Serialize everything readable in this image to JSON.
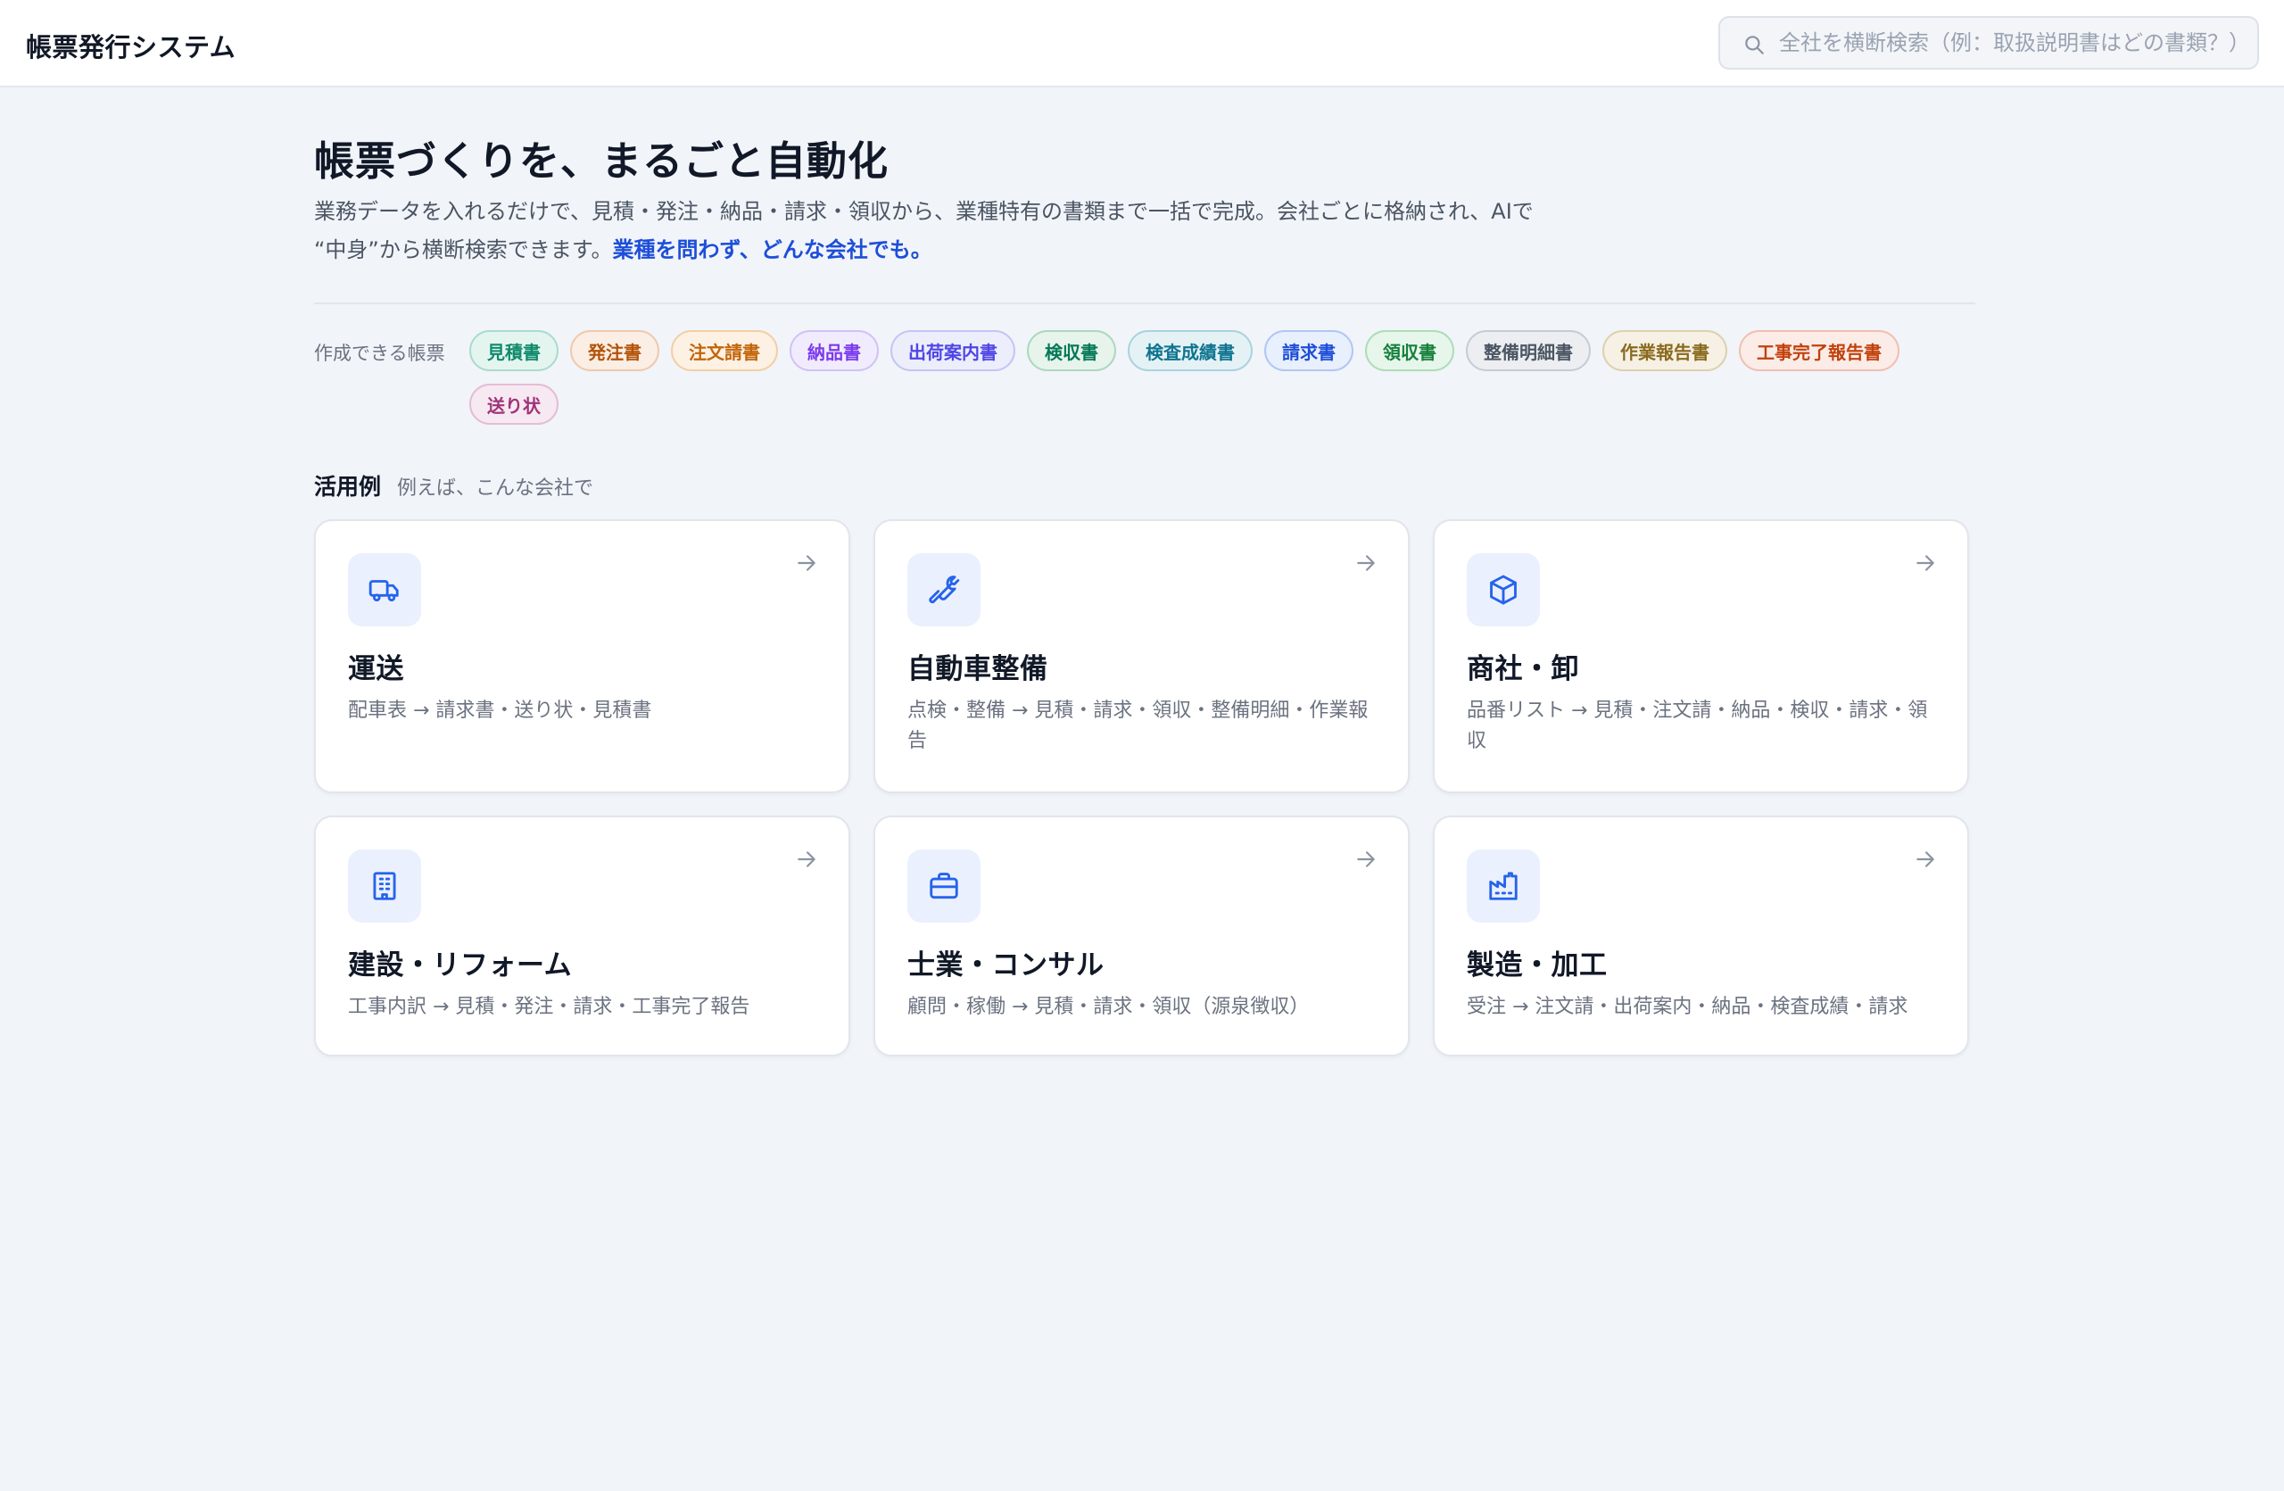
{
  "header": {
    "title": "帳票発行システム",
    "search_placeholder": "全社を横断検索（例：取扱説明書はどの書類？）"
  },
  "hero": {
    "title": "帳票づくりを、まるごと自動化",
    "desc_line1": "業務データを入れるだけで、見積・発注・納品・請求・領収から、業種特有の書類まで一括で完成。会社ごとに格納され、AIで",
    "desc_line2": "“中身”から横断検索できます。",
    "desc_emphasis": "業種を問わず、どんな会社でも。"
  },
  "forms": {
    "label": "作成できる帳票",
    "tags": [
      {
        "label": "見積書",
        "color": "#0f8a6a",
        "bg": "#e4f5ef",
        "border": "#a9dccb"
      },
      {
        "label": "発注書",
        "color": "#b45309",
        "bg": "#fbeee4",
        "border": "#f0c9ad"
      },
      {
        "label": "注文請書",
        "color": "#c2650a",
        "bg": "#fcf1e3",
        "border": "#f2cfa3"
      },
      {
        "label": "納品書",
        "color": "#7c3aed",
        "bg": "#f1ecfd",
        "border": "#d1c2f4"
      },
      {
        "label": "出荷案内書",
        "color": "#4f46e5",
        "bg": "#eceefc",
        "border": "#c3c6f2"
      },
      {
        "label": "検収書",
        "color": "#047857",
        "bg": "#e6f4ec",
        "border": "#acd8bf"
      },
      {
        "label": "検査成績書",
        "color": "#0e7490",
        "bg": "#e5f2f5",
        "border": "#a8d3dd"
      },
      {
        "label": "請求書",
        "color": "#1d4ed8",
        "bg": "#e8effd",
        "border": "#b0c7f4"
      },
      {
        "label": "領収書",
        "color": "#15803d",
        "bg": "#e7f6ea",
        "border": "#aedcb9"
      },
      {
        "label": "整備明細書",
        "color": "#4b5563",
        "bg": "#eceef1",
        "border": "#c7ccd4"
      },
      {
        "label": "作業報告書",
        "color": "#8a6a1f",
        "bg": "#f6f1e4",
        "border": "#ddd0ae"
      },
      {
        "label": "工事完了報告書",
        "color": "#c2410c",
        "bg": "#fcece8",
        "border": "#f0bfb2"
      },
      {
        "label": "送り状",
        "color": "#a0337a",
        "bg": "#f7e9f2",
        "border": "#e3bdd5"
      }
    ]
  },
  "examples": {
    "heading": "活用例",
    "sub": "例えば、こんな会社で",
    "accent": "#2563eb",
    "cards": [
      {
        "icon": "truck-icon",
        "title": "運送",
        "desc": "配車表 → 請求書・送り状・見積書"
      },
      {
        "icon": "wrench-icon",
        "title": "自動車整備",
        "desc": "点検・整備 → 見積・請求・領収・整備明細・作業報告"
      },
      {
        "icon": "box-icon",
        "title": "商社・卸",
        "desc": "品番リスト → 見積・注文請・納品・検収・請求・領収"
      },
      {
        "icon": "building-icon",
        "title": "建設・リフォーム",
        "desc": "工事内訳 → 見積・発注・請求・工事完了報告"
      },
      {
        "icon": "briefcase-icon",
        "title": "士業・コンサル",
        "desc": "顧問・稼働 → 見積・請求・領収（源泉徴収）"
      },
      {
        "icon": "factory-icon",
        "title": "製造・加工",
        "desc": "受注 → 注文請・出荷案内・納品・検査成績・請求"
      }
    ]
  }
}
